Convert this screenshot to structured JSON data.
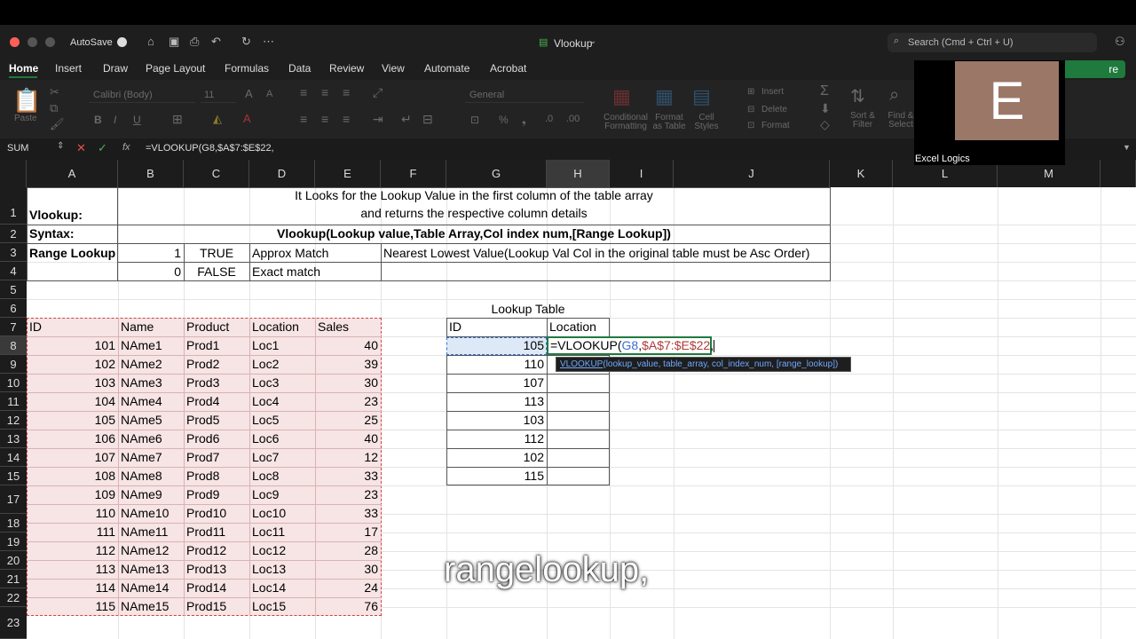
{
  "window": {
    "title": "Vlookup",
    "autosave": "AutoSave",
    "search_placeholder": "Search (Cmd + Ctrl + U)"
  },
  "ribbon_tabs": [
    "Home",
    "Insert",
    "Draw",
    "Page Layout",
    "Formulas",
    "Data",
    "Review",
    "View",
    "Automate",
    "Acrobat"
  ],
  "ribbon": {
    "paste": "Paste",
    "font": "Calibri (Body)",
    "size": "11",
    "number_format": "General",
    "cond_fmt": "Conditional Formatting",
    "format_table": "Format as Table",
    "cell_styles": "Cell Styles",
    "insert": "Insert",
    "delete": "Delete",
    "format": "Format",
    "sort_filter": "Sort & Filter",
    "find_select": "Find & Select",
    "share": "re"
  },
  "formula_bar": {
    "name_box": "SUM",
    "fx": "fx",
    "formula": "=VLOOKUP(G8,$A$7:$E$22,"
  },
  "columns": [
    "A",
    "B",
    "C",
    "D",
    "E",
    "F",
    "G",
    "H",
    "I",
    "J",
    "K",
    "L",
    "M"
  ],
  "rows": [
    "1",
    "2",
    "3",
    "4",
    "5",
    "6",
    "7",
    "8",
    "9",
    "10",
    "11",
    "12",
    "13",
    "14",
    "15",
    "17",
    "18",
    "19",
    "20",
    "21",
    "22",
    "23"
  ],
  "header_block": {
    "vlookup_label": "Vlookup:",
    "desc_line1": "It Looks for the Lookup Value in the first column of the table array",
    "desc_line2": "and returns the respective column details",
    "syntax_label": "Syntax:",
    "syntax": "Vlookup(Lookup value,Table Array,Col index num,[Range Lookup])",
    "range_label": "Range Lookup",
    "r1_num": "1",
    "r1_bool": "TRUE",
    "r1_type": "Approx Match",
    "r1_note": "Nearest Lowest Value(Lookup Val Col in the original table must be Asc Order)",
    "r2_num": "0",
    "r2_bool": "FALSE",
    "r2_type": "Exact match"
  },
  "main_table": {
    "headers": [
      "ID",
      "Name",
      "Product",
      "Location",
      "Sales"
    ],
    "rows": [
      [
        "101",
        "NAme1",
        "Prod1",
        "Loc1",
        "40"
      ],
      [
        "102",
        "NAme2",
        "Prod2",
        "Loc2",
        "39"
      ],
      [
        "103",
        "NAme3",
        "Prod3",
        "Loc3",
        "30"
      ],
      [
        "104",
        "NAme4",
        "Prod4",
        "Loc4",
        "23"
      ],
      [
        "105",
        "NAme5",
        "Prod5",
        "Loc5",
        "25"
      ],
      [
        "106",
        "NAme6",
        "Prod6",
        "Loc6",
        "40"
      ],
      [
        "107",
        "NAme7",
        "Prod7",
        "Loc7",
        "12"
      ],
      [
        "108",
        "NAme8",
        "Prod8",
        "Loc8",
        "33"
      ],
      [
        "109",
        "NAme9",
        "Prod9",
        "Loc9",
        "23"
      ],
      [
        "110",
        "NAme10",
        "Prod10",
        "Loc10",
        "33"
      ],
      [
        "111",
        "NAme11",
        "Prod11",
        "Loc11",
        "17"
      ],
      [
        "112",
        "NAme12",
        "Prod12",
        "Loc12",
        "28"
      ],
      [
        "113",
        "NAme13",
        "Prod13",
        "Loc13",
        "30"
      ],
      [
        "114",
        "NAme14",
        "Prod14",
        "Loc14",
        "24"
      ],
      [
        "115",
        "NAme15",
        "Prod15",
        "Loc15",
        "76"
      ]
    ]
  },
  "lookup_table": {
    "title": "Lookup Table",
    "headers": [
      "ID",
      "Location"
    ],
    "ids": [
      "105",
      "110",
      "107",
      "113",
      "103",
      "112",
      "102",
      "115"
    ],
    "editing_formula_prefix": "=VLOOKUP(",
    "editing_ref1": "G8",
    "editing_sep": ",",
    "editing_ref2": "$A$7:$E$22",
    "editing_tail": ","
  },
  "tooltip": {
    "fn": "VLOOKUP",
    "args": "(lookup_value, table_array, col_index_num, [range_lookup])"
  },
  "overlay": {
    "avatar_letter": "E",
    "name": "Excel Logics"
  },
  "caption": "rangelookup,",
  "colors": {
    "accent": "#1f7a3e",
    "table_fill": "#f7e4e4",
    "selection": "#dde9f7",
    "ref1": "#3b6fd1",
    "ref2": "#b03a3a"
  }
}
